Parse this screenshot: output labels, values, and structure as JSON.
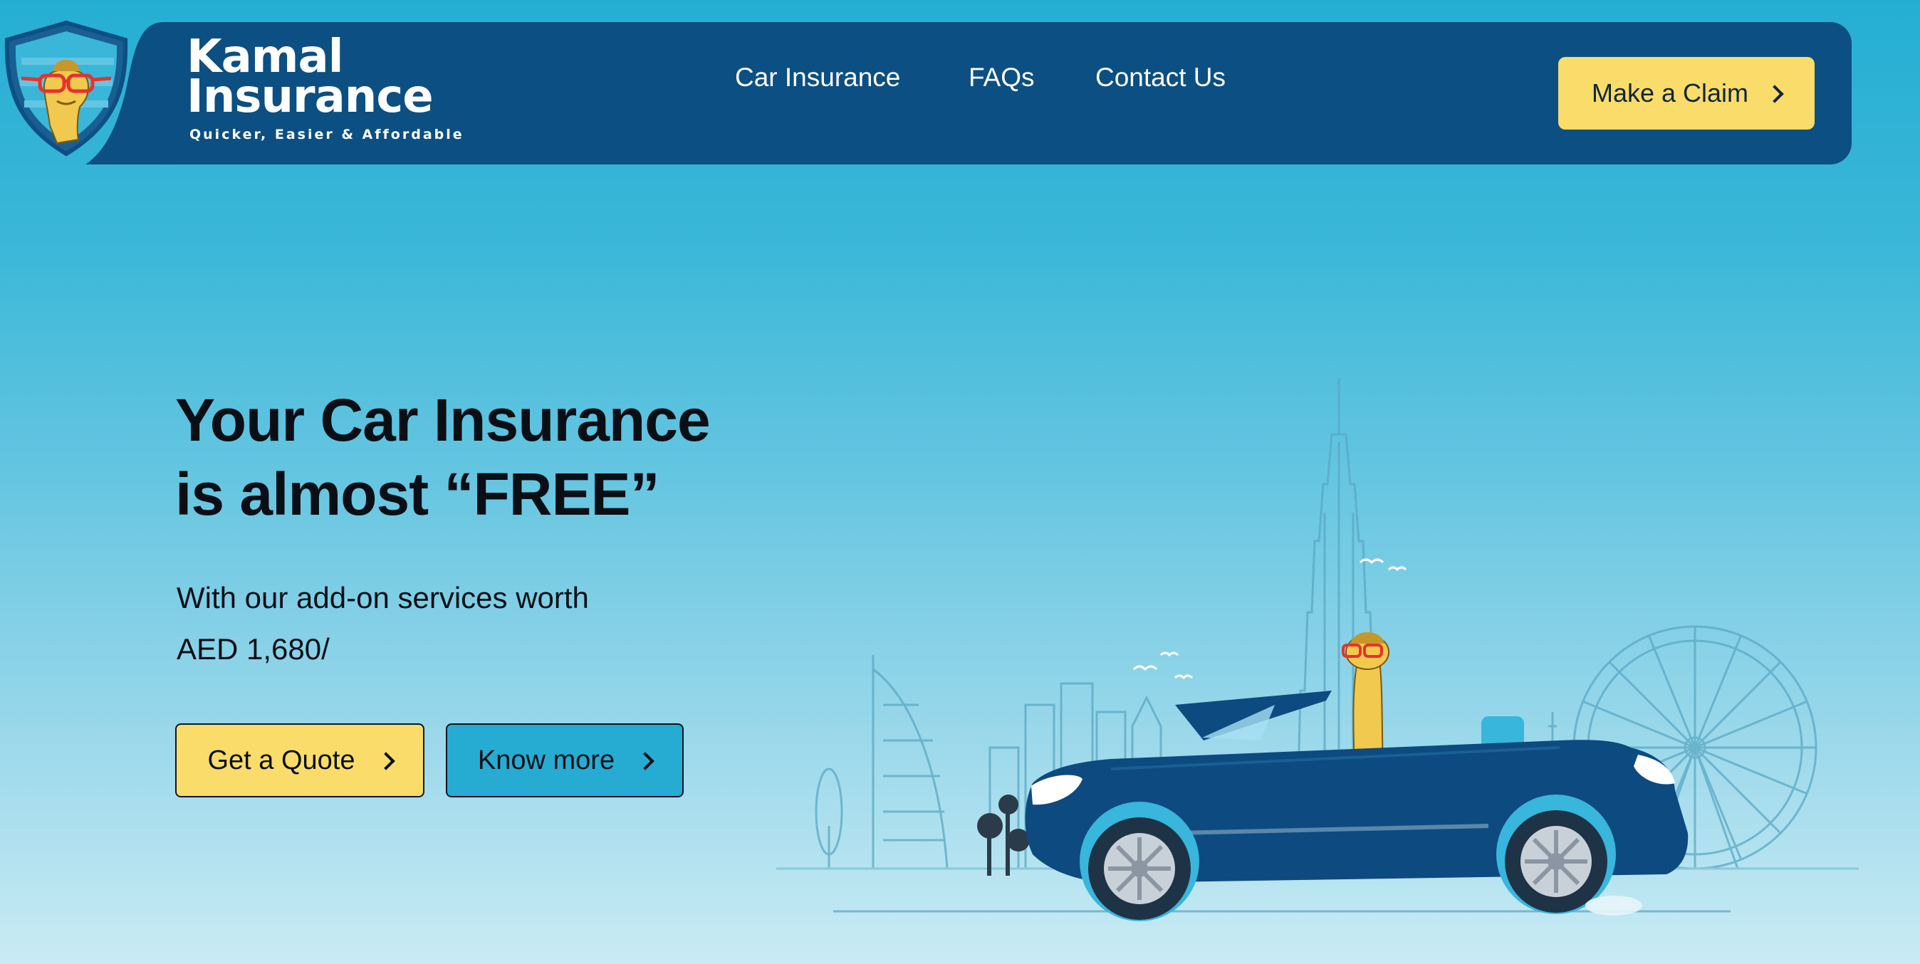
{
  "brand": {
    "name_line1": "Kamal",
    "name_line2": "Insurance",
    "tagline": "Quicker, Easier & Affordable"
  },
  "nav": {
    "items": [
      "Car Insurance",
      "FAQs",
      "Contact Us"
    ],
    "claim_label": "Make a Claim"
  },
  "hero": {
    "title_line1": "Your Car Insurance",
    "title_line2": "is almost “FREE”",
    "subtitle_line1": "With our add-on services worth",
    "subtitle_line2": "AED 1,680/"
  },
  "cta": {
    "quote_label": "Get a Quote",
    "more_label": "Know more"
  },
  "colors": {
    "background_top": "#25aed3",
    "background_bottom": "#c9ebf4",
    "nav_bg": "#0c4f82",
    "accent_yellow": "#f9dc6a",
    "accent_blue": "#26acd2",
    "car_body": "#0d4a80"
  },
  "icons": {
    "logo": "camel-shield-logo",
    "chevron": "chevron-right-icon"
  }
}
